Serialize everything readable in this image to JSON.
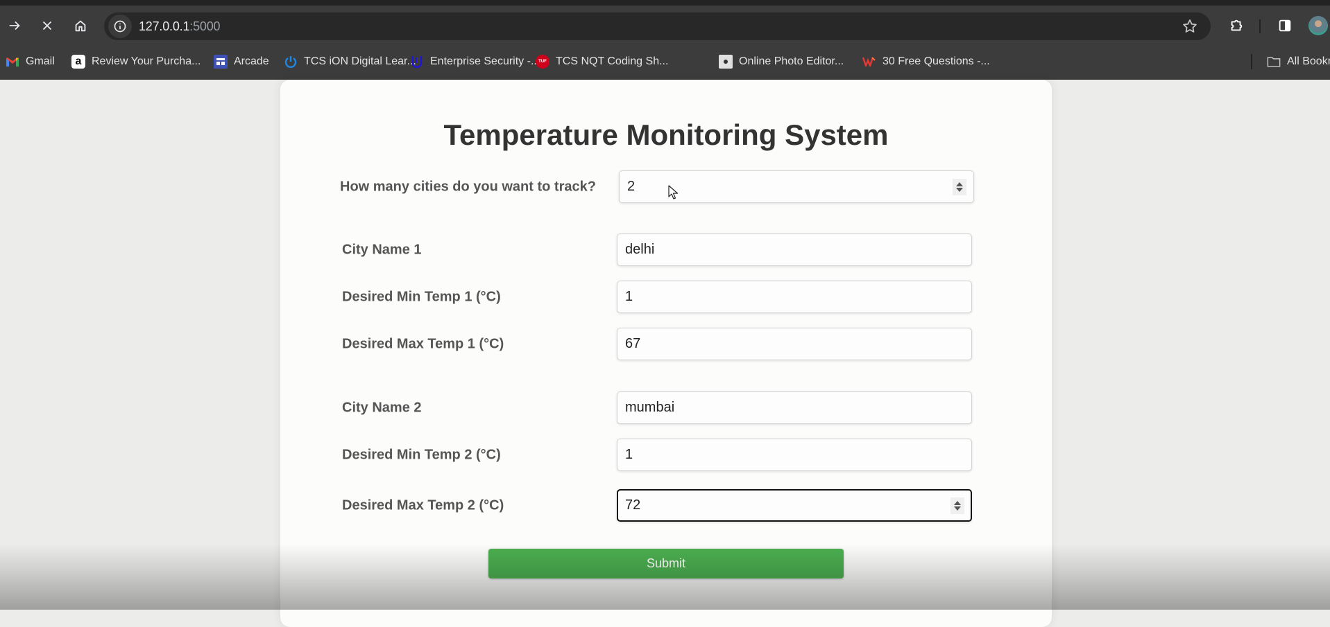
{
  "browser": {
    "url_host": "127.0.0.1",
    "url_port": ":5000",
    "bookmarks": [
      {
        "label": "Gmail",
        "icon": "gmail-icon"
      },
      {
        "label": "Review Your Purcha...",
        "icon": "amazon-icon"
      },
      {
        "label": "Arcade",
        "icon": "arcade-icon"
      },
      {
        "label": "TCS iON Digital Lear...",
        "icon": "tcs-ion-icon"
      },
      {
        "label": "Enterprise Security -...",
        "icon": "udacity-icon"
      },
      {
        "label": "TCS NQT Coding Sh...",
        "icon": "tuf-icon"
      },
      {
        "label": "Online Photo Editor...",
        "icon": "photo-editor-icon"
      },
      {
        "label": "30 Free Questions -...",
        "icon": "w-logo-icon"
      }
    ],
    "all_bookmarks_label": "All Bookm"
  },
  "page": {
    "title": "Temperature Monitoring System",
    "city_count": {
      "label": "How many cities do you want to track?",
      "value": "2"
    },
    "cities": [
      {
        "name_label": "City Name 1",
        "name_value": "delhi",
        "min_label": "Desired Min Temp 1 (°C)",
        "min_value": "1",
        "max_label": "Desired Max Temp 1 (°C)",
        "max_value": "67"
      },
      {
        "name_label": "City Name 2",
        "name_value": "mumbai",
        "min_label": "Desired Min Temp 2 (°C)",
        "min_value": "1",
        "max_label": "Desired Max Temp 2 (°C)",
        "max_value": "72"
      }
    ],
    "submit_label": "Submit"
  },
  "colors": {
    "accent_green": "#4caf50",
    "chrome_dark": "#3c3c3c",
    "page_bg": "#ecedeb"
  }
}
